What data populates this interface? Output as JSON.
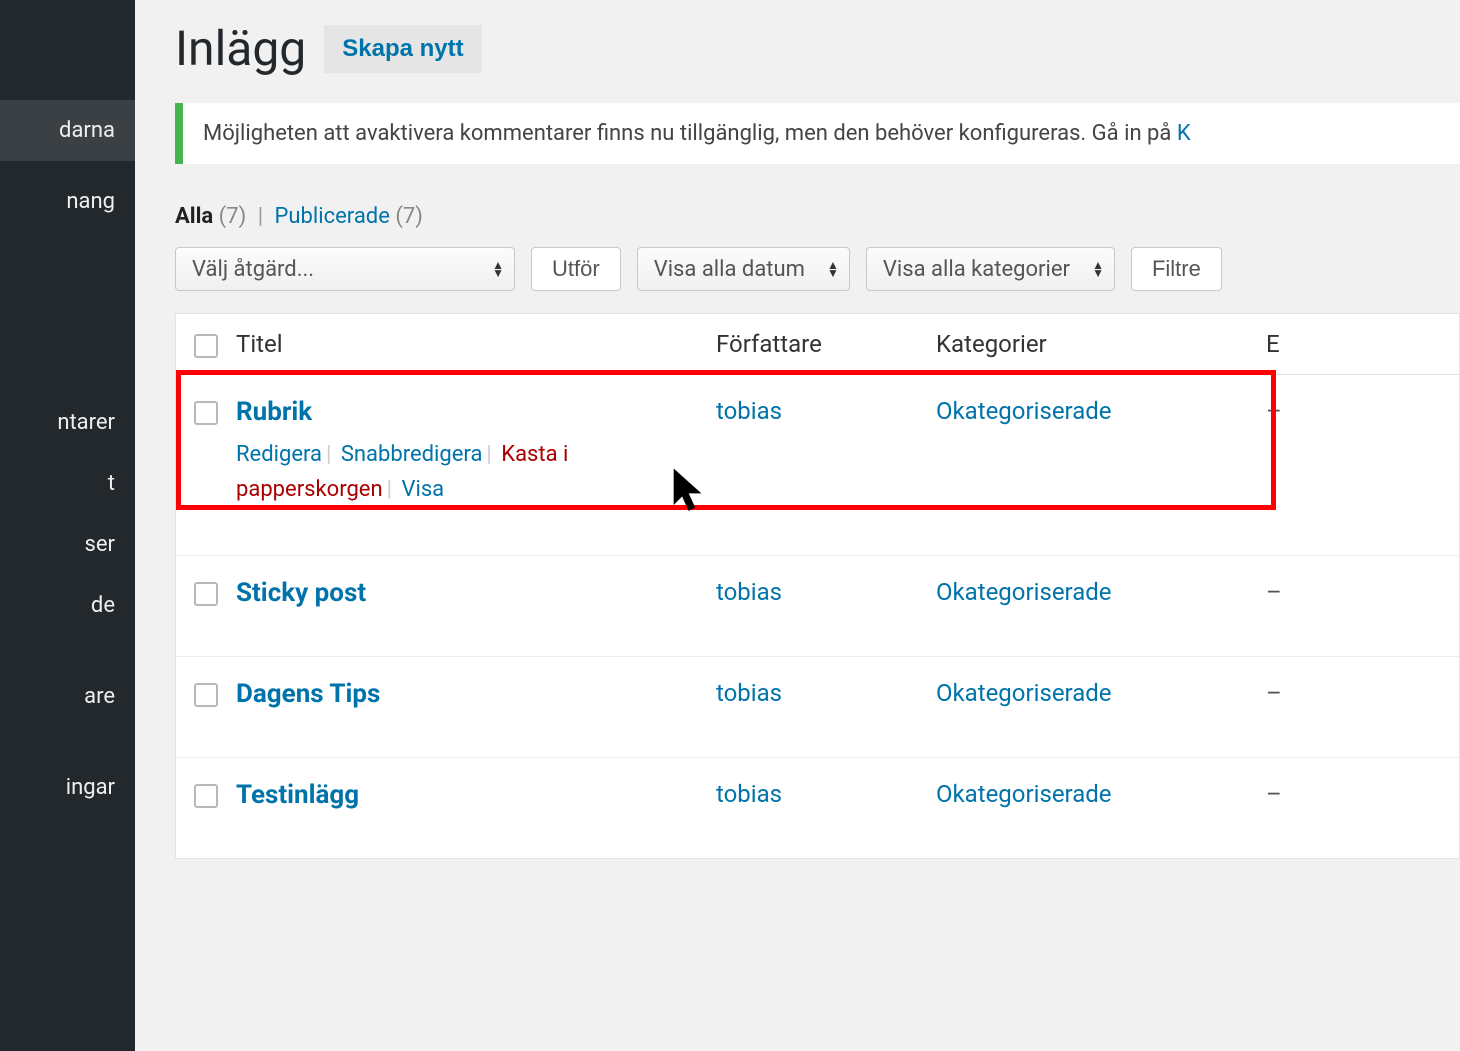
{
  "sidebar": {
    "items": [
      {
        "label": "darna",
        "highlight": true
      },
      {
        "label": "nang"
      },
      {
        "label": "ntarer"
      },
      {
        "label": "t"
      },
      {
        "label": "ser"
      },
      {
        "label": "de"
      },
      {
        "label": "are"
      },
      {
        "label": "ingar"
      }
    ]
  },
  "header": {
    "title": "Inlägg",
    "add_new": "Skapa nytt"
  },
  "notice": {
    "text": "Möjligheten att avaktivera kommentarer finns nu tillgänglig, men den behöver konfigureras. Gå in på ",
    "link": "K"
  },
  "filters": {
    "all_label": "Alla",
    "all_count": "(7)",
    "published_label": "Publicerade",
    "published_count": "(7)",
    "bulk_action": "Välj åtgärd...",
    "apply": "Utför",
    "date": "Visa alla datum",
    "category": "Visa alla kategorier",
    "filter": "Filtre"
  },
  "table": {
    "columns": {
      "title": "Titel",
      "author": "Författare",
      "categories": "Kategorier",
      "extra": "E"
    },
    "row_actions": {
      "edit": "Redigera",
      "quick_edit": "Snabbredigera",
      "trash": "Kasta i papperskorgen",
      "view": "Visa"
    },
    "rows": [
      {
        "title": "Rubrik",
        "author": "tobias",
        "category": "Okategoriserade",
        "extra": "–",
        "show_actions": true
      },
      {
        "title": "Sticky post",
        "author": "tobias",
        "category": "Okategoriserade",
        "extra": "–"
      },
      {
        "title": "Dagens Tips",
        "author": "tobias",
        "category": "Okategoriserade",
        "extra": "–"
      },
      {
        "title": "Testinlägg",
        "author": "tobias",
        "category": "Okategoriserade",
        "extra": "–"
      }
    ]
  }
}
